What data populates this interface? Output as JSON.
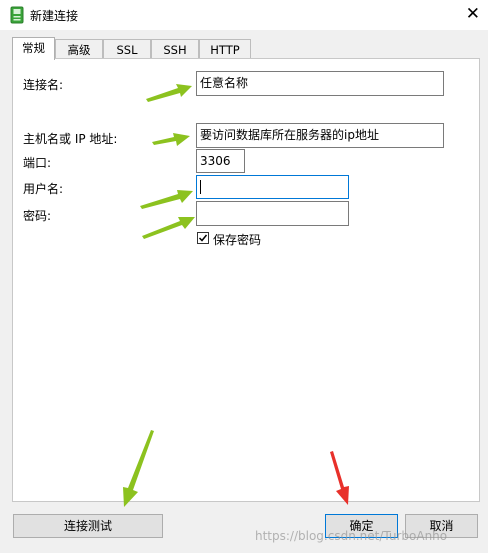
{
  "window": {
    "title": "新建连接",
    "close_glyph": "✕"
  },
  "tabs": [
    {
      "label": "常规",
      "active": true
    },
    {
      "label": "高级"
    },
    {
      "label": "SSL"
    },
    {
      "label": "SSH"
    },
    {
      "label": "HTTP"
    }
  ],
  "form": {
    "connection_name": {
      "label": "连接名:",
      "value": "任意名称"
    },
    "host": {
      "label": "主机名或 IP 地址:",
      "value": "要访问数据库所在服务器的ip地址"
    },
    "port": {
      "label": "端口:",
      "value": "3306"
    },
    "username": {
      "label": "用户名:",
      "value": ""
    },
    "password": {
      "label": "密码:",
      "value": ""
    },
    "save_password": {
      "label": "保存密码",
      "checked": true
    }
  },
  "buttons": {
    "test": "连接测试",
    "ok": "确定",
    "cancel": "取消"
  },
  "annotations": {
    "arrow_colors": {
      "green": "#8cc21f",
      "red": "#e8302a"
    }
  },
  "watermark": "https://blog.csdn.net/TurboAnho"
}
